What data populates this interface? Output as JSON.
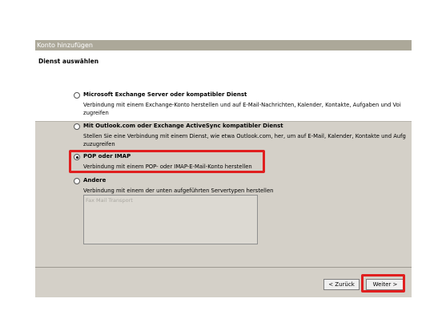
{
  "window": {
    "title": "Konto hinzufügen"
  },
  "header": {
    "title": "Dienst auswählen"
  },
  "options": [
    {
      "label": "Microsoft Exchange Server oder kompatibler Dienst",
      "description_line1": "Verbindung mit einem Exchange-Konto herstellen und auf E-Mail-Nachrichten, Kalender, Kontakte, Aufgaben und Voi",
      "description_line2": "zugreifen",
      "selected": false
    },
    {
      "label": "Mit Outlook.com oder Exchange ActiveSync kompatibler Dienst",
      "description_line1": "Stellen Sie eine Verbindung mit einem Dienst, wie etwa Outlook.com, her, um auf E-Mail, Kalender, Kontakte und Aufg",
      "description_line2": "zuzugreifen",
      "selected": false
    },
    {
      "label": "POP oder IMAP",
      "description_line1": "Verbindung mit einem POP- oder IMAP-E-Mail-Konto herstellen",
      "selected": true
    },
    {
      "label": "Andere",
      "description_line1": "Verbindung mit einem der unten aufgeführten Servertypen herstellen",
      "selected": false
    }
  ],
  "server_types": [
    "Fax Mail Transport"
  ],
  "buttons": {
    "back": "< Zurück",
    "next": "Weiter >"
  },
  "colors": {
    "highlight": "#e01f1f",
    "dialog_bg": "#d4d0c8"
  }
}
